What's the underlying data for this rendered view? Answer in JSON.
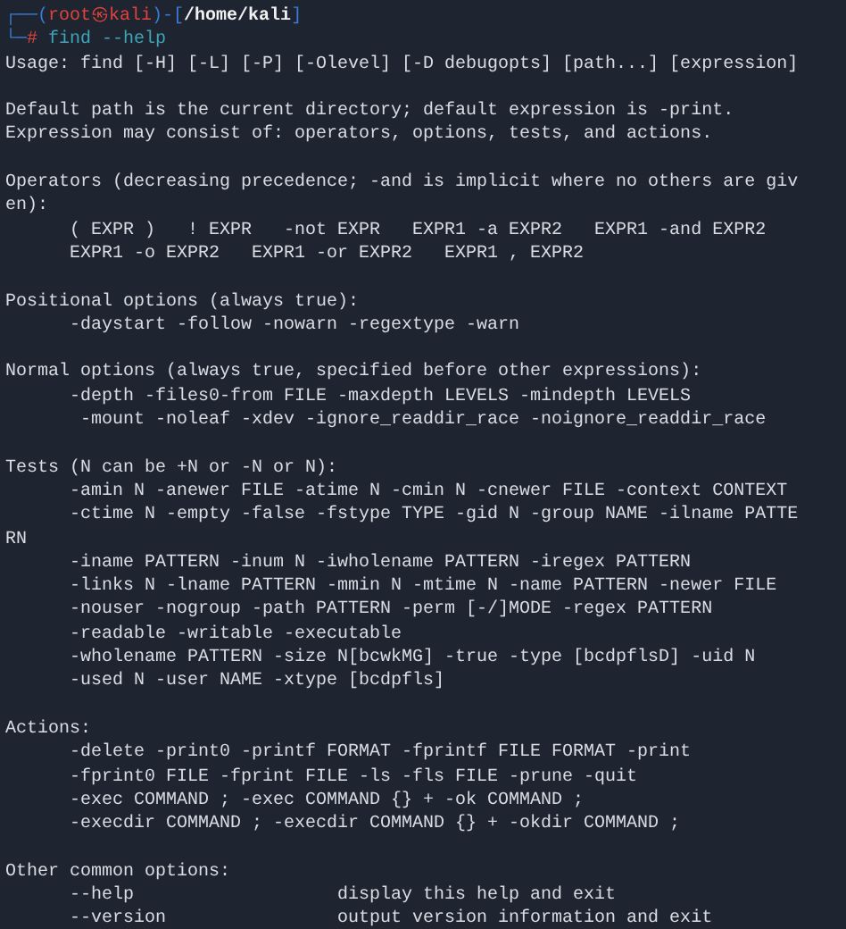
{
  "prompt": {
    "lines": [
      [
        {
          "kind": "frame",
          "text": "┌──("
        },
        {
          "kind": "user",
          "text": "root㉿kali"
        },
        {
          "kind": "frame",
          "text": ")-["
        },
        {
          "kind": "path",
          "text": "/home/kali"
        },
        {
          "kind": "frame",
          "text": "]"
        }
      ],
      [
        {
          "kind": "frame",
          "text": "└─"
        },
        {
          "kind": "sigil",
          "text": "#"
        },
        {
          "kind": "command",
          "text": " find --help"
        }
      ]
    ]
  },
  "output": [
    [
      "Usage: find [-H] [-L] [-P] [-Olevel] [-D debugopts] [path...] [expression]"
    ],
    [
      "Default path is the current directory; default expression is -print.",
      "Expression may consist of: operators, options, tests, and actions."
    ],
    [
      "Operators (decreasing precedence; -and is implicit where no others are giv",
      "en):",
      "      ( EXPR )   ! EXPR   -not EXPR   EXPR1 -a EXPR2   EXPR1 -and EXPR2",
      "      EXPR1 -o EXPR2   EXPR1 -or EXPR2   EXPR1 , EXPR2"
    ],
    [
      "Positional options (always true):",
      "      -daystart -follow -nowarn -regextype -warn"
    ],
    [
      "Normal options (always true, specified before other expressions):",
      "      -depth -files0-from FILE -maxdepth LEVELS -mindepth LEVELS",
      "       -mount -noleaf -xdev -ignore_readdir_race -noignore_readdir_race"
    ],
    [
      "Tests (N can be +N or -N or N):",
      "      -amin N -anewer FILE -atime N -cmin N -cnewer FILE -context CONTEXT",
      "      -ctime N -empty -false -fstype TYPE -gid N -group NAME -ilname PATTE",
      "RN",
      "      -iname PATTERN -inum N -iwholename PATTERN -iregex PATTERN",
      "      -links N -lname PATTERN -mmin N -mtime N -name PATTERN -newer FILE",
      "      -nouser -nogroup -path PATTERN -perm [-/]MODE -regex PATTERN",
      "      -readable -writable -executable",
      "      -wholename PATTERN -size N[bcwkMG] -true -type [bcdpflsD] -uid N",
      "      -used N -user NAME -xtype [bcdpfls]"
    ],
    [
      "Actions:",
      "      -delete -print0 -printf FORMAT -fprintf FILE FORMAT -print",
      "      -fprint0 FILE -fprint FILE -ls -fls FILE -prune -quit",
      "      -exec COMMAND ; -exec COMMAND {} + -ok COMMAND ;",
      "      -execdir COMMAND ; -execdir COMMAND {} + -okdir COMMAND ;"
    ],
    [
      "Other common options:",
      "      --help                   display this help and exit",
      "      --version                output version information and exit"
    ]
  ]
}
